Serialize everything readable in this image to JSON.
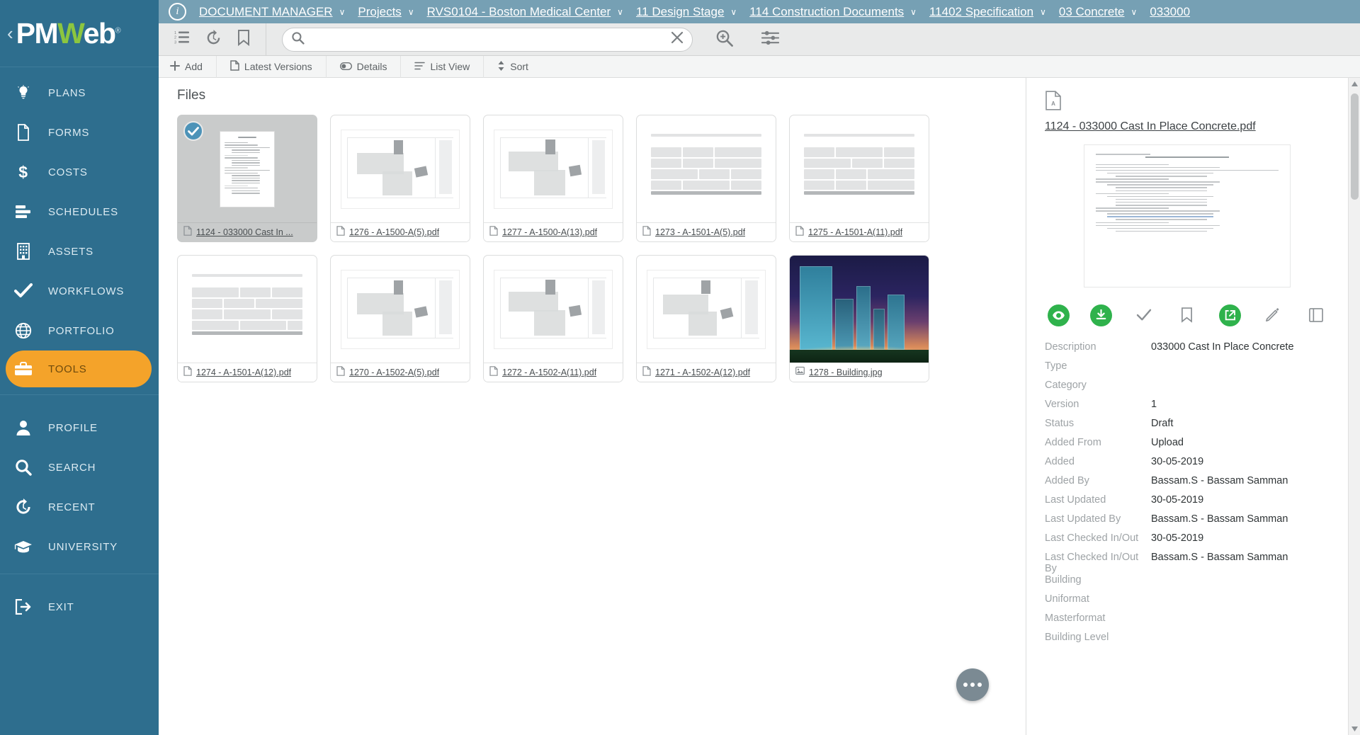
{
  "app": {
    "logo_pm": "PM",
    "logo_w": "W",
    "logo_eb": "eb",
    "logo_reg": "®",
    "collapse_chevron": "‹"
  },
  "breadcrumb": {
    "items": [
      {
        "label": "DOCUMENT MANAGER",
        "caret": "∨"
      },
      {
        "label": "Projects",
        "caret": "∨"
      },
      {
        "label": "RVS0104 - Boston Medical Center",
        "caret": "∨"
      },
      {
        "label": "11 Design Stage",
        "caret": "∨"
      },
      {
        "label": "114 Construction Documents",
        "caret": "∨"
      },
      {
        "label": "11402 Specification",
        "caret": "∨"
      },
      {
        "label": "03 Concrete",
        "caret": "∨"
      },
      {
        "label": "033000",
        "caret": ""
      }
    ]
  },
  "sidebar": {
    "items": [
      {
        "label": "PLANS",
        "icon": "lightbulb-icon",
        "active": false
      },
      {
        "label": "FORMS",
        "icon": "document-icon",
        "active": false
      },
      {
        "label": "COSTS",
        "icon": "dollar-icon",
        "active": false
      },
      {
        "label": "SCHEDULES",
        "icon": "bars-icon",
        "active": false
      },
      {
        "label": "ASSETS",
        "icon": "building-icon",
        "active": false
      },
      {
        "label": "WORKFLOWS",
        "icon": "checkmark-icon",
        "active": false
      },
      {
        "label": "PORTFOLIO",
        "icon": "globe-icon",
        "active": false
      },
      {
        "label": "TOOLS",
        "icon": "toolbox-icon",
        "active": true
      }
    ],
    "items2": [
      {
        "label": "PROFILE",
        "icon": "user-icon"
      },
      {
        "label": "SEARCH",
        "icon": "magnifier-icon"
      },
      {
        "label": "RECENT",
        "icon": "history-icon"
      },
      {
        "label": "UNIVERSITY",
        "icon": "graduation-cap-icon"
      }
    ],
    "items3": [
      {
        "label": "EXIT",
        "icon": "exit-icon"
      }
    ]
  },
  "toolbar": {
    "icons": [
      "numbered-list-icon",
      "history-icon",
      "bookmark-icon"
    ],
    "search_value": "",
    "search_placeholder": "",
    "zoom_icon": "magnifier-plus-icon",
    "filter_icon": "sliders-icon"
  },
  "actionbar": {
    "add": "Add",
    "latest_versions": "Latest Versions",
    "details": "Details",
    "list_view": "List View",
    "sort": "Sort"
  },
  "files": {
    "title": "Files",
    "items": [
      {
        "name": "1124 - 033000 Cast In ...",
        "kind": "doc",
        "icon": "pdf-icon",
        "selected": true
      },
      {
        "name": "1276 - A-1500-A(5).pdf",
        "kind": "plan",
        "icon": "pdf-icon",
        "selected": false
      },
      {
        "name": "1277 - A-1500-A(13).pdf",
        "kind": "plan",
        "icon": "pdf-icon",
        "selected": false
      },
      {
        "name": "1273 - A-1501-A(5).pdf",
        "kind": "sched",
        "icon": "pdf-icon",
        "selected": false
      },
      {
        "name": "1275 - A-1501-A(11).pdf",
        "kind": "sched",
        "icon": "pdf-icon",
        "selected": false
      },
      {
        "name": "1274 - A-1501-A(12).pdf",
        "kind": "sched",
        "icon": "pdf-icon",
        "selected": false
      },
      {
        "name": "1270 - A-1502-A(5).pdf",
        "kind": "plan",
        "icon": "pdf-icon",
        "selected": false
      },
      {
        "name": "1272 - A-1502-A(11).pdf",
        "kind": "plan",
        "icon": "pdf-icon",
        "selected": false
      },
      {
        "name": "1271 - A-1502-A(12).pdf",
        "kind": "plan",
        "icon": "pdf-icon",
        "selected": false
      },
      {
        "name": "1278 - Building.jpg",
        "kind": "image",
        "icon": "image-icon",
        "selected": false
      }
    ],
    "more_button": "more-options-icon"
  },
  "details_panel": {
    "file_icon": "pdf-icon",
    "file_name": "1124 - 033000 Cast In Place Concrete.pdf",
    "preview_title": "SECTION 033000 - CAST-IN-PLACE CONCRETE",
    "actions": [
      {
        "name": "view-icon",
        "style": "circle"
      },
      {
        "name": "download-icon",
        "style": "circle"
      },
      {
        "name": "approve-icon",
        "style": "plain"
      },
      {
        "name": "bookmark-icon",
        "style": "plain"
      },
      {
        "name": "open-external-icon",
        "style": "circle"
      },
      {
        "name": "markup-icon",
        "style": "plain"
      },
      {
        "name": "compare-icon",
        "style": "plain"
      }
    ],
    "fields": [
      {
        "label": "Description",
        "value": "033000 Cast In Place Concrete"
      },
      {
        "label": "Type",
        "value": ""
      },
      {
        "label": "Category",
        "value": ""
      },
      {
        "label": "Version",
        "value": "1"
      },
      {
        "label": "Status",
        "value": "Draft"
      },
      {
        "label": "Added From",
        "value": "Upload"
      },
      {
        "label": "Added",
        "value": "30-05-2019"
      },
      {
        "label": "Added By",
        "value": "Bassam.S - Bassam Samman"
      },
      {
        "label": "Last Updated",
        "value": "30-05-2019"
      },
      {
        "label": "Last Updated By",
        "value": "Bassam.S - Bassam Samman"
      },
      {
        "label": "Last Checked In/Out",
        "value": "30-05-2019"
      },
      {
        "label": "Last Checked In/Out By",
        "value": "Bassam.S - Bassam Samman"
      },
      {
        "label": "Building",
        "value": ""
      },
      {
        "label": "Uniformat",
        "value": ""
      },
      {
        "label": "Masterformat",
        "value": ""
      },
      {
        "label": "Building Level",
        "value": ""
      }
    ]
  },
  "colors": {
    "sidebar_bg": "#2e6e8e",
    "accent_orange": "#f4a32a",
    "logo_green": "#8cc63f",
    "breadcrumb_bg": "#76a0b4",
    "action_green": "#2fb24c",
    "select_blue": "#4d93b8"
  }
}
